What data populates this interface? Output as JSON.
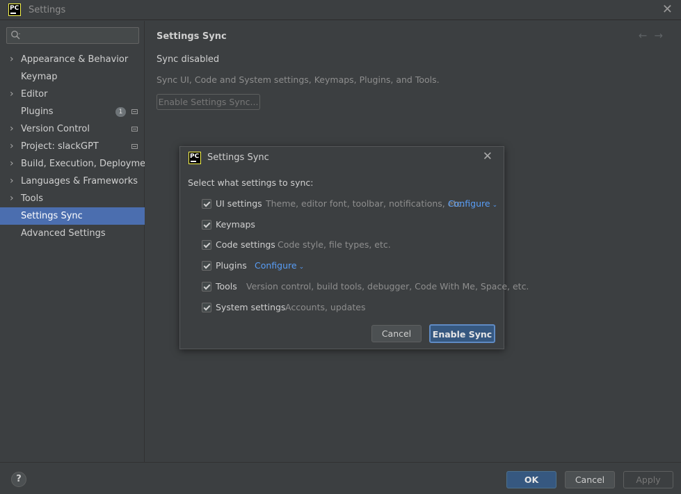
{
  "window": {
    "title": "Settings"
  },
  "sidebar": {
    "search": {
      "placeholder": "",
      "value": ""
    },
    "items": [
      {
        "label": "Appearance & Behavior"
      },
      {
        "label": "Keymap"
      },
      {
        "label": "Editor"
      },
      {
        "label": "Plugins",
        "badge": "1"
      },
      {
        "label": "Version Control"
      },
      {
        "label": "Project: slackGPT"
      },
      {
        "label": "Build, Execution, Deployment"
      },
      {
        "label": "Languages & Frameworks"
      },
      {
        "label": "Tools"
      },
      {
        "label": "Settings Sync",
        "selected": true
      },
      {
        "label": "Advanced Settings"
      }
    ]
  },
  "content": {
    "title": "Settings Sync",
    "status": "Sync disabled",
    "description": "Sync UI, Code and System settings, Keymaps, Plugins, and Tools.",
    "enable_button": "Enable Settings Sync..."
  },
  "dialog": {
    "title": "Settings Sync",
    "prompt": "Select what settings to sync:",
    "options": [
      {
        "label": "UI settings",
        "desc": "Theme, editor font, toolbar, notifications, etc.",
        "configure": "Configure",
        "checked": true
      },
      {
        "label": "Keymaps",
        "checked": true
      },
      {
        "label": "Code settings",
        "desc": "Code style, file types, etc.",
        "checked": true
      },
      {
        "label": "Plugins",
        "configure": "Configure",
        "checked": true
      },
      {
        "label": "Tools",
        "desc": "Version control, build tools, debugger, Code With Me, Space, etc.",
        "checked": true
      },
      {
        "label": "System settings",
        "desc": "Accounts, updates",
        "checked": true
      }
    ],
    "cancel": "Cancel",
    "enable": "Enable Sync"
  },
  "footer": {
    "help": "?",
    "ok": "OK",
    "cancel": "Cancel",
    "apply": "Apply"
  },
  "colors": {
    "accent": "#4b6eaf",
    "link": "#589df6",
    "primary_button": "#365880",
    "background": "#3c3f41"
  }
}
